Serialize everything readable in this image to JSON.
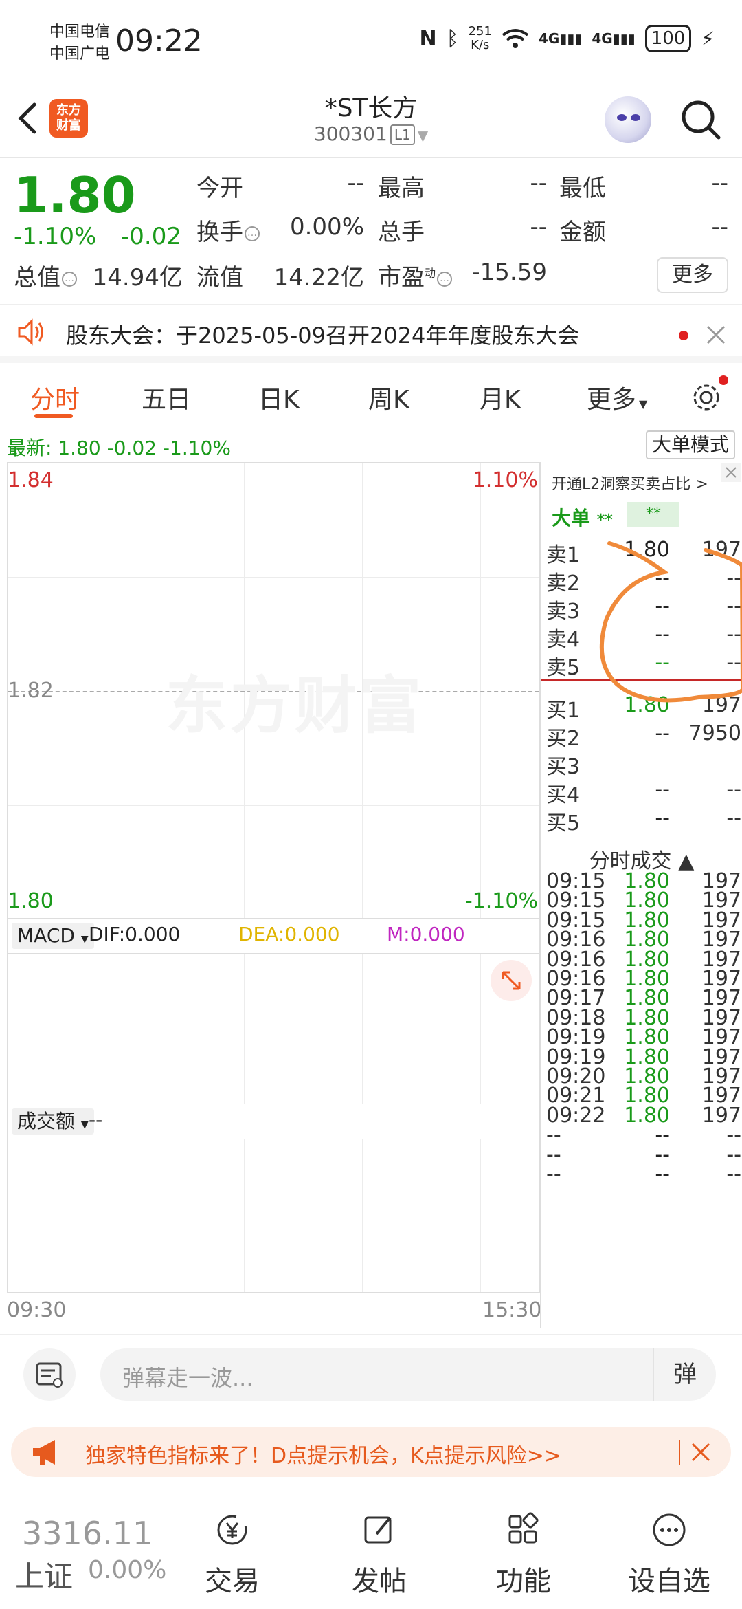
{
  "status_bar": {
    "carrier1": "中国电信",
    "carrier2": "中国广电",
    "time": "09:22",
    "net_speed_top": "251",
    "net_speed_bottom": "K/s",
    "sig1": "4G",
    "sig2": "4G",
    "battery": "100"
  },
  "header": {
    "logo_text_line1": "东方",
    "logo_text_line2": "财富",
    "stock_name": "*ST长方",
    "stock_code": "300301",
    "level": "L1"
  },
  "quote": {
    "price": "1.80",
    "change_pct": "-1.10%",
    "change_abs": "-0.02",
    "fields": {
      "open_label": "今开",
      "open_value": "--",
      "high_label": "最高",
      "high_value": "--",
      "low_label": "最低",
      "low_value": "--",
      "turnover_label": "换手",
      "turnover_value": "0.00%",
      "volume_label": "总手",
      "volume_value": "--",
      "amount_label": "金额",
      "amount_value": "--",
      "mktcap_label": "总值",
      "mktcap_value": "14.94亿",
      "float_label": "流值",
      "float_value": "14.22亿",
      "pe_label": "市盈",
      "pe_sup": "动",
      "pe_value": "-15.59"
    },
    "more_button": "更多"
  },
  "notice": {
    "text": "股东大会：于2025-05-09召开2024年年度股东大会"
  },
  "tabs": [
    "分时",
    "五日",
    "日K",
    "周K",
    "月K",
    "更多"
  ],
  "latest": {
    "text": "最新:  1.80  -0.02  -1.10%",
    "big_order_mode": "大单模式"
  },
  "chart": {
    "y_top": "1.84",
    "y_mid": "1.82",
    "y_bottom": "1.80",
    "pct_top": "1.10%",
    "pct_bottom": "-1.10%",
    "watermark": "东方财富",
    "x_start": "09:30",
    "x_end": "15:30",
    "accent_up": "#d32f2f",
    "accent_down": "#1a9a1a"
  },
  "macd": {
    "selector": "MACD",
    "dif": "DIF:0.000",
    "dea": "DEA:0.000",
    "m": "M:0.000",
    "dea_color": "#e0b400",
    "m_color": "#c026c0"
  },
  "volume": {
    "selector": "成交额",
    "value": "--"
  },
  "orderbook": {
    "l2_link": "开通L2洞察买卖占比 >",
    "big_label": "大单",
    "big_value1": "**",
    "big_value2": "**",
    "asks": [
      {
        "label": "卖5",
        "price": "--",
        "vol": "--"
      },
      {
        "label": "卖4",
        "price": "--",
        "vol": "--"
      },
      {
        "label": "卖3",
        "price": "--",
        "vol": "--"
      },
      {
        "label": "卖2",
        "price": "--",
        "vol": "--"
      },
      {
        "label": "卖1",
        "price": "1.80",
        "vol": "197"
      }
    ],
    "bids": [
      {
        "label": "买1",
        "price": "1.80",
        "vol": "197"
      },
      {
        "label": "买2",
        "price": "--",
        "vol": "7950"
      },
      {
        "label": "买3",
        "price": "",
        "vol": ""
      },
      {
        "label": "买4",
        "price": "--",
        "vol": "--"
      },
      {
        "label": "买5",
        "price": "--",
        "vol": "--"
      }
    ],
    "trades_title": "分时成交 ▲",
    "trades": [
      {
        "time": "09:15",
        "price": "1.80",
        "vol": "197"
      },
      {
        "time": "09:15",
        "price": "1.80",
        "vol": "197"
      },
      {
        "time": "09:15",
        "price": "1.80",
        "vol": "197"
      },
      {
        "time": "09:16",
        "price": "1.80",
        "vol": "197"
      },
      {
        "time": "09:16",
        "price": "1.80",
        "vol": "197"
      },
      {
        "time": "09:16",
        "price": "1.80",
        "vol": "197"
      },
      {
        "time": "09:17",
        "price": "1.80",
        "vol": "197"
      },
      {
        "time": "09:18",
        "price": "1.80",
        "vol": "197"
      },
      {
        "time": "09:19",
        "price": "1.80",
        "vol": "197"
      },
      {
        "time": "09:19",
        "price": "1.80",
        "vol": "197"
      },
      {
        "time": "09:20",
        "price": "1.80",
        "vol": "197"
      },
      {
        "time": "09:21",
        "price": "1.80",
        "vol": "197"
      },
      {
        "time": "09:22",
        "price": "1.80",
        "vol": "197"
      },
      {
        "time": "--",
        "price": "--",
        "vol": "--"
      },
      {
        "time": "--",
        "price": "--",
        "vol": "--"
      },
      {
        "time": "--",
        "price": "--",
        "vol": "--"
      }
    ]
  },
  "comment": {
    "placeholder": "弹幕走一波...",
    "danmu_button": "弹"
  },
  "promo": {
    "text": "独家特色指标来了！D点提示机会，K点提示风险>>"
  },
  "bottom_nav": {
    "index_value": "3316.11",
    "index_name": "上证",
    "index_pct": "0.00%",
    "items": [
      {
        "label": "交易",
        "icon": "yen-icon"
      },
      {
        "label": "发帖",
        "icon": "edit-icon"
      },
      {
        "label": "功能",
        "icon": "grid-icon"
      },
      {
        "label": "设自选",
        "icon": "more-dots-icon"
      }
    ]
  }
}
